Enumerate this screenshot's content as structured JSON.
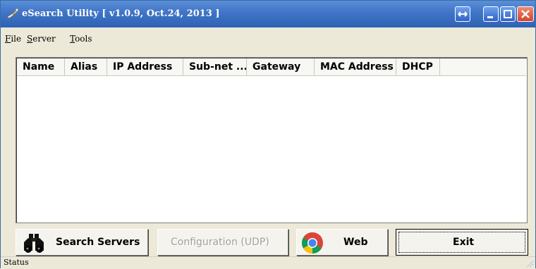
{
  "window": {
    "title": "eSearch Utility [ v1.0.9, Oct.24, 2013 ]"
  },
  "menu": {
    "items": [
      {
        "accel": "F",
        "rest": "ile"
      },
      {
        "accel": "S",
        "rest": "erver"
      },
      {
        "accel": "T",
        "rest": "ools"
      }
    ]
  },
  "table": {
    "columns": [
      "Name",
      "Alias",
      "IP Address",
      "Sub-net ...",
      "Gateway",
      "MAC Address",
      "DHCP"
    ],
    "rows": []
  },
  "buttons": {
    "search": "Search Servers",
    "config": "Configuration (UDP)",
    "web": "Web",
    "exit": "Exit"
  },
  "status": {
    "text": "Status"
  },
  "colors": {
    "titlebar": "#3f74c6",
    "close_button": "#d2452a"
  }
}
